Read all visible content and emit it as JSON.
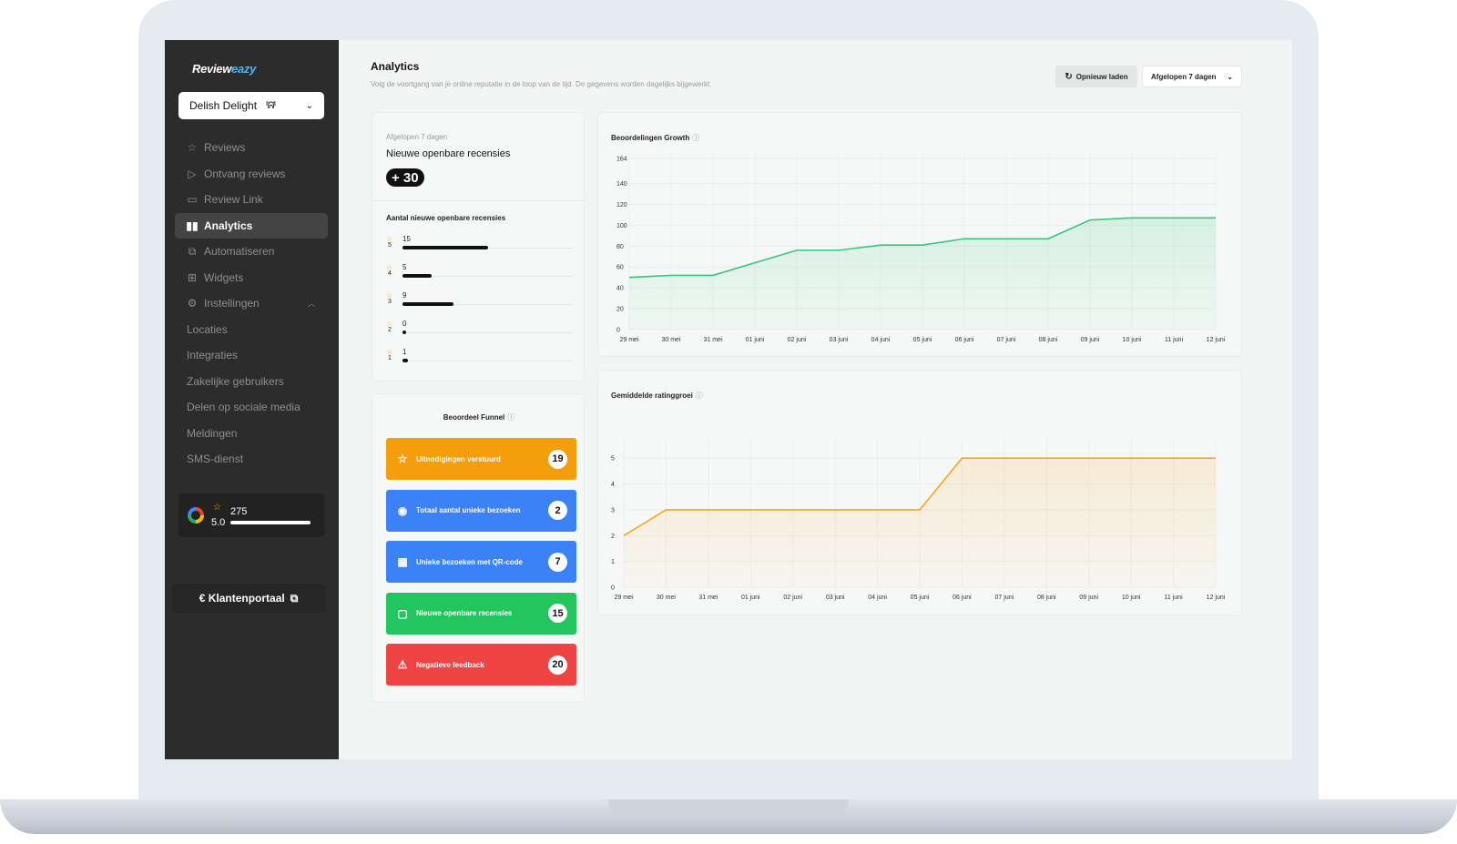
{
  "app": {
    "logo_main": "Review",
    "logo_accent": "eazy"
  },
  "venue": {
    "name": "Delish Delight",
    "logo_text": "⸢ᕱ⸣"
  },
  "sidebar": {
    "items": [
      {
        "label": "Reviews",
        "icon": "☆"
      },
      {
        "label": "Ontvang reviews",
        "icon": "▷"
      },
      {
        "label": "Review Link",
        "icon": "▭"
      },
      {
        "label": "Analytics",
        "icon": "▮▮"
      },
      {
        "label": "Automatiseren",
        "icon": "⧉"
      },
      {
        "label": "Widgets",
        "icon": "⊞"
      },
      {
        "label": "Instellingen",
        "icon": "⚙"
      },
      {
        "label": "Locaties"
      },
      {
        "label": "Integraties"
      },
      {
        "label": "Zakelijke gebruikers"
      },
      {
        "label": "Delen op sociale media"
      },
      {
        "label": "Meldingen"
      },
      {
        "label": "SMS-dienst"
      }
    ],
    "rating": {
      "count": "275",
      "score": "5.0"
    },
    "portal_label": "€ Klantenportaal"
  },
  "header": {
    "title": "Analytics",
    "subtitle": "Volg de voortgang van je online reputatie in de loop van de tijd. De gegevens worden dagelijks bijgewerkt.",
    "reload_label": "Opnieuw laden",
    "period_label": "Afgelopen 7 dagen"
  },
  "summary": {
    "period": "Afgelopen 7 dagen",
    "title": "Nieuwe openbare recensies",
    "badge": "+ 30",
    "breakdown_title": "Aantal nieuwe openbare recensies",
    "rows": [
      {
        "stars": "5",
        "count": "15",
        "fraction": 0.5
      },
      {
        "stars": "4",
        "count": "5",
        "fraction": 0.17
      },
      {
        "stars": "3",
        "count": "9",
        "fraction": 0.3
      },
      {
        "stars": "2",
        "count": "0",
        "fraction": 0
      },
      {
        "stars": "1",
        "count": "1",
        "fraction": 0.03
      }
    ]
  },
  "funnel": {
    "title": "Beoordeel Funnel",
    "steps": [
      {
        "label": "Uitnodigingen verstuurd",
        "value": "19",
        "color": "#f59e0b",
        "icon": "☆"
      },
      {
        "label": "Totaal aantal unieke bezoeken",
        "value": "2",
        "color": "#3b82f6",
        "icon": "◉"
      },
      {
        "label": "Unieke bezoeken met QR-code",
        "value": "7",
        "color": "#3b82f6",
        "icon": "▦"
      },
      {
        "label": "Nieuwe openbare recensies",
        "value": "15",
        "color": "#22c55e",
        "icon": "▢"
      },
      {
        "label": "Negatieve feedback",
        "value": "20",
        "color": "#ef4444",
        "icon": "⚠"
      }
    ]
  },
  "chart_data": [
    {
      "type": "area",
      "title": "Beoordelingen Growth",
      "x": [
        "29 mei",
        "30 mei",
        "31 mei",
        "01 juni",
        "02 juni",
        "03 juni",
        "04 juni",
        "05 juni",
        "06 juni",
        "07 juni",
        "08 juni",
        "09 juni",
        "10 juni",
        "11 juni",
        "12 juni"
      ],
      "y_ticks": [
        0,
        20,
        40,
        60,
        80,
        100,
        120,
        140,
        164
      ],
      "ylim": [
        0,
        164
      ],
      "series": [
        {
          "values": [
            50,
            52,
            52,
            64,
            76,
            76,
            81,
            81,
            87,
            87,
            87,
            105,
            107,
            107,
            107
          ]
        }
      ],
      "color": "#34c77b",
      "grid": true
    },
    {
      "type": "area",
      "title": "Gemiddelde ratinggroei",
      "x": [
        "29 mei",
        "30 mei",
        "31 mei",
        "01 juni",
        "02 juni",
        "03 juni",
        "04 juni",
        "05 juni",
        "06 juni",
        "07 juni",
        "08 juni",
        "09 juni",
        "10 juni",
        "11 juni",
        "12 juni"
      ],
      "y_ticks": [
        0,
        1,
        2,
        3,
        4,
        5
      ],
      "ylim": [
        0,
        5.5
      ],
      "series": [
        {
          "values": [
            2,
            3,
            3,
            3,
            3,
            3,
            3,
            3,
            5,
            5,
            5,
            5,
            5,
            5,
            5
          ]
        }
      ],
      "color": "#f5a524",
      "grid": true
    }
  ]
}
